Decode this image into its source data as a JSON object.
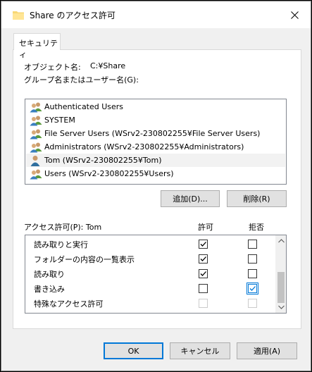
{
  "window": {
    "title": "Share のアクセス許可",
    "close_label": "×"
  },
  "tab": {
    "label": "セキュリティ"
  },
  "object": {
    "label": "オブジェクト名:",
    "value": "C:¥Share"
  },
  "groups": {
    "label": "グループ名またはユーザー名(G):",
    "items": [
      {
        "label": "Authenticated Users",
        "icon": "user-group-icon",
        "selected": false
      },
      {
        "label": "SYSTEM",
        "icon": "user-group-icon",
        "selected": false
      },
      {
        "label": "File Server Users (WSrv2-230802255¥File Server Users)",
        "icon": "user-group-icon",
        "selected": false
      },
      {
        "label": "Administrators (WSrv2-230802255¥Administrators)",
        "icon": "user-group-icon",
        "selected": false
      },
      {
        "label": "Tom (WSrv2-230802255¥Tom)",
        "icon": "user-icon",
        "selected": true
      },
      {
        "label": "Users (WSrv2-230802255¥Users)",
        "icon": "user-group-icon",
        "selected": false
      }
    ]
  },
  "buttons": {
    "add": "追加(D)...",
    "remove": "削除(R)",
    "ok": "OK",
    "cancel": "キャンセル",
    "apply": "適用(A)"
  },
  "permissions": {
    "label": "アクセス許可(P): Tom",
    "allow_header": "許可",
    "deny_header": "拒否",
    "rows": [
      {
        "name": "読み取りと実行",
        "allow": true,
        "deny": false,
        "disabled": false
      },
      {
        "name": "フォルダーの内容の一覧表示",
        "allow": true,
        "deny": false,
        "disabled": false
      },
      {
        "name": "読み取り",
        "allow": true,
        "deny": false,
        "disabled": false
      },
      {
        "name": "書き込み",
        "allow": false,
        "deny": true,
        "disabled": false,
        "deny_focus": true
      },
      {
        "name": "特殊なアクセス許可",
        "allow": false,
        "deny": false,
        "disabled": true
      }
    ]
  },
  "colors": {
    "accent": "#0078d7",
    "panel": "#ffffff",
    "face": "#f0f0f0"
  }
}
